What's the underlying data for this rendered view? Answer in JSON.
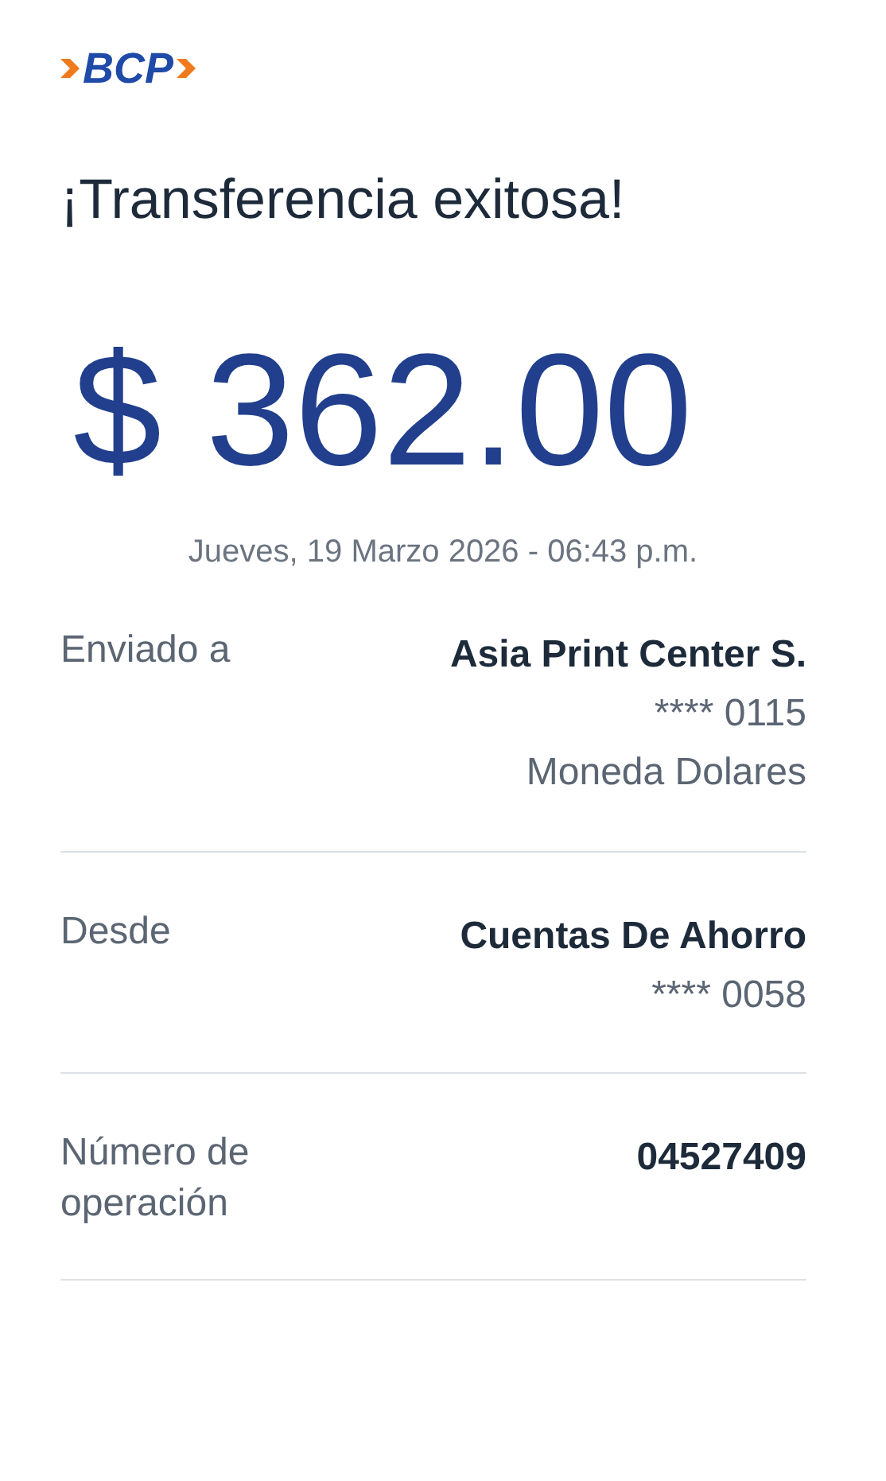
{
  "logo": {
    "text": "BCP"
  },
  "title": "¡Transferencia exitosa!",
  "amount": "$ 362.00",
  "datetime": "Jueves, 19 Marzo 2026 - 06:43 p.m.",
  "details": [
    {
      "label": "Enviado a",
      "lines": [
        "Asia Print Center S.",
        "**** 0115",
        "Moneda Dolares"
      ]
    },
    {
      "label": "Desde",
      "lines": [
        "Cuentas De Ahorro",
        "**** 0058"
      ]
    },
    {
      "label": "Número de operación",
      "lines": [
        "04527409"
      ]
    }
  ]
}
